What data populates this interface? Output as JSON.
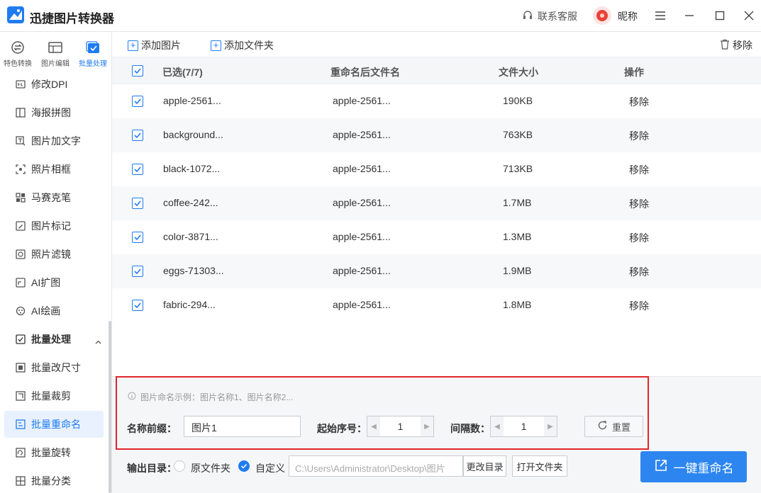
{
  "app": {
    "title": "迅捷图片转换器",
    "support": "联系客服",
    "nickname": "昵称"
  },
  "tabs": [
    {
      "label": "特色转换",
      "icon": "convert-icon"
    },
    {
      "label": "图片编辑",
      "icon": "image-edit-icon"
    },
    {
      "label": "批量处理",
      "icon": "batch-icon",
      "active": true
    }
  ],
  "menu": [
    {
      "label": "修改DPI",
      "icon": "dpi-icon"
    },
    {
      "label": "海报拼图",
      "icon": "collage-icon"
    },
    {
      "label": "图片加文字",
      "icon": "add-text-icon"
    },
    {
      "label": "照片相框",
      "icon": "frame-icon"
    },
    {
      "label": "马赛克笔",
      "icon": "mosaic-icon"
    },
    {
      "label": "图片标记",
      "icon": "mark-icon"
    },
    {
      "label": "照片滤镜",
      "icon": "filter-icon"
    },
    {
      "label": "AI扩图",
      "icon": "ai-expand-icon"
    },
    {
      "label": "AI绘画",
      "icon": "ai-paint-icon"
    },
    {
      "label": "批量处理",
      "icon": "batch-group-icon",
      "group": true
    },
    {
      "label": "批量改尺寸",
      "icon": "resize-icon"
    },
    {
      "label": "批量裁剪",
      "icon": "crop-icon"
    },
    {
      "label": "批量重命名",
      "icon": "rename-icon",
      "active": true
    },
    {
      "label": "批量旋转",
      "icon": "rotate-icon"
    },
    {
      "label": "批量分类",
      "icon": "classify-icon"
    }
  ],
  "toolbar": {
    "add_image": "添加图片",
    "add_folder": "添加文件夹",
    "remove": "移除"
  },
  "table": {
    "headers": {
      "selected": "已选(7/7)",
      "renamed": "重命名后文件名",
      "size": "文件大小",
      "action": "操作"
    },
    "rows": [
      {
        "name": "apple-2561...",
        "renamed": "apple-2561...",
        "size": "190KB",
        "action": "移除"
      },
      {
        "name": "background...",
        "renamed": "apple-2561...",
        "size": "763KB",
        "action": "移除"
      },
      {
        "name": "black-1072...",
        "renamed": "apple-2561...",
        "size": "713KB",
        "action": "移除"
      },
      {
        "name": "coffee-242...",
        "renamed": "apple-2561...",
        "size": "1.7MB",
        "action": "移除"
      },
      {
        "name": "color-3871...",
        "renamed": "apple-2561...",
        "size": "1.3MB",
        "action": "移除"
      },
      {
        "name": "eggs-71303...",
        "renamed": "apple-2561...",
        "size": "1.9MB",
        "action": "移除"
      },
      {
        "name": "fabric-294...",
        "renamed": "apple-2561...",
        "size": "1.8MB",
        "action": "移除"
      }
    ]
  },
  "settings": {
    "hint": "图片命名示例：图片名称1、图片名称2...",
    "prefix_label": "名称前缀：",
    "prefix_value": "图片1",
    "start_label": "起始序号：",
    "start_value": "1",
    "step_label": "间隔数：",
    "step_value": "1",
    "reset": "重置"
  },
  "output": {
    "label": "输出目录：",
    "original": "原文件夹",
    "custom": "自定义",
    "path": "C:\\Users\\Administrator\\Desktop\\图片",
    "change_dir": "更改目录",
    "open_folder": "打开文件夹"
  },
  "run_button": "一键重命名",
  "colors": {
    "accent": "#1f7cf0",
    "highlight": "#e0252b"
  }
}
